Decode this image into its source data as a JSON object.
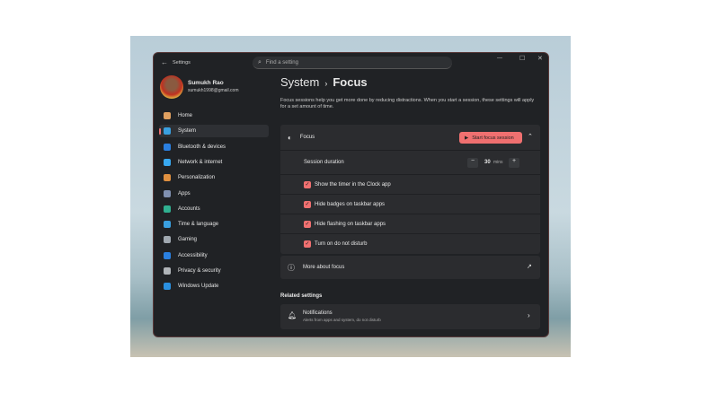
{
  "window": {
    "back": "←",
    "title": "Settings",
    "search_placeholder": "Find a setting",
    "minimize": "—",
    "maximize": "☐",
    "close": "✕"
  },
  "user": {
    "name": "Sumukh Rao",
    "email": "sumukh1998@gmail.com"
  },
  "sidebar": {
    "items": [
      {
        "label": "Home",
        "color": "#e0a060"
      },
      {
        "label": "System",
        "color": "#3aa0e0"
      },
      {
        "label": "Bluetooth & devices",
        "color": "#2a7fe0"
      },
      {
        "label": "Network & internet",
        "color": "#38a8f0"
      },
      {
        "label": "Personalization",
        "color": "#e09040"
      },
      {
        "label": "Apps",
        "color": "#8090b0"
      },
      {
        "label": "Accounts",
        "color": "#30b090"
      },
      {
        "label": "Time & language",
        "color": "#3aa0e0"
      },
      {
        "label": "Gaming",
        "color": "#a0a8b0"
      },
      {
        "label": "Accessibility",
        "color": "#2a80e0"
      },
      {
        "label": "Privacy & security",
        "color": "#b0b4b8"
      },
      {
        "label": "Windows Update",
        "color": "#2a90e0"
      }
    ]
  },
  "header": {
    "parent": "System",
    "sep": "›",
    "title": "Focus",
    "description": "Focus sessions help you get more done by reducing distractions. When you start a session, these settings will apply for a set amount of time."
  },
  "focus": {
    "label": "Focus",
    "start_button": "Start focus session",
    "chevron": "⌃",
    "duration_label": "Session duration",
    "duration_value": "30",
    "duration_unit": "mins",
    "minus": "−",
    "plus": "+",
    "options": [
      {
        "label": "Show the timer in the Clock app",
        "checked": true
      },
      {
        "label": "Hide badges on taskbar apps",
        "checked": true
      },
      {
        "label": "Hide flashing on taskbar apps",
        "checked": true
      },
      {
        "label": "Turn on do not disturb",
        "checked": true
      }
    ]
  },
  "more": {
    "label": "More about focus"
  },
  "related": {
    "heading": "Related settings",
    "notifications_title": "Notifications",
    "notifications_sub": "Alerts from apps and system, do not disturb"
  },
  "accent": "#f07070"
}
